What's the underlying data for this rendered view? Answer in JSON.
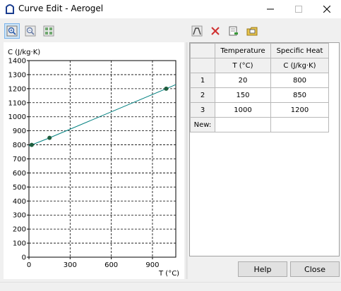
{
  "window": {
    "title": "Curve Edit - Aerogel",
    "minimize_icon": "minimize-icon",
    "maximize_icon": "maximize-icon",
    "close_icon": "close-icon"
  },
  "toolbar_left": {
    "icons": [
      "zoom-in-icon",
      "zoom-out-icon",
      "zoom-fit-icon"
    ]
  },
  "toolbar_right": {
    "icons": [
      "curve-icon",
      "delete-icon",
      "import-icon",
      "export-icon"
    ]
  },
  "chart_data": {
    "type": "line",
    "x": [
      20,
      150,
      1000
    ],
    "y": [
      800,
      850,
      1200
    ],
    "ylabel": "C (J/kg·K)",
    "xlabel": "T (°C)",
    "xlim": [
      0,
      1070
    ],
    "ylim": [
      0,
      1400
    ],
    "xticks": [
      0,
      300,
      600,
      900
    ],
    "yticks": [
      0,
      100,
      200,
      300,
      400,
      500,
      600,
      700,
      800,
      900,
      1000,
      1100,
      1200,
      1300,
      1400
    ],
    "grid": true,
    "line_color": "#008080",
    "marker_color": "#1e5e3e"
  },
  "table": {
    "headers": [
      "Temperature",
      "Specific Heat"
    ],
    "units": [
      "T (°C)",
      "C (J/kg·K)"
    ],
    "rows": [
      {
        "index": "1",
        "temperature": "20",
        "specific_heat": "800"
      },
      {
        "index": "2",
        "temperature": "150",
        "specific_heat": "850"
      },
      {
        "index": "3",
        "temperature": "1000",
        "specific_heat": "1200"
      }
    ],
    "new_label": "New:"
  },
  "buttons": {
    "help": "Help",
    "close": "Close"
  }
}
